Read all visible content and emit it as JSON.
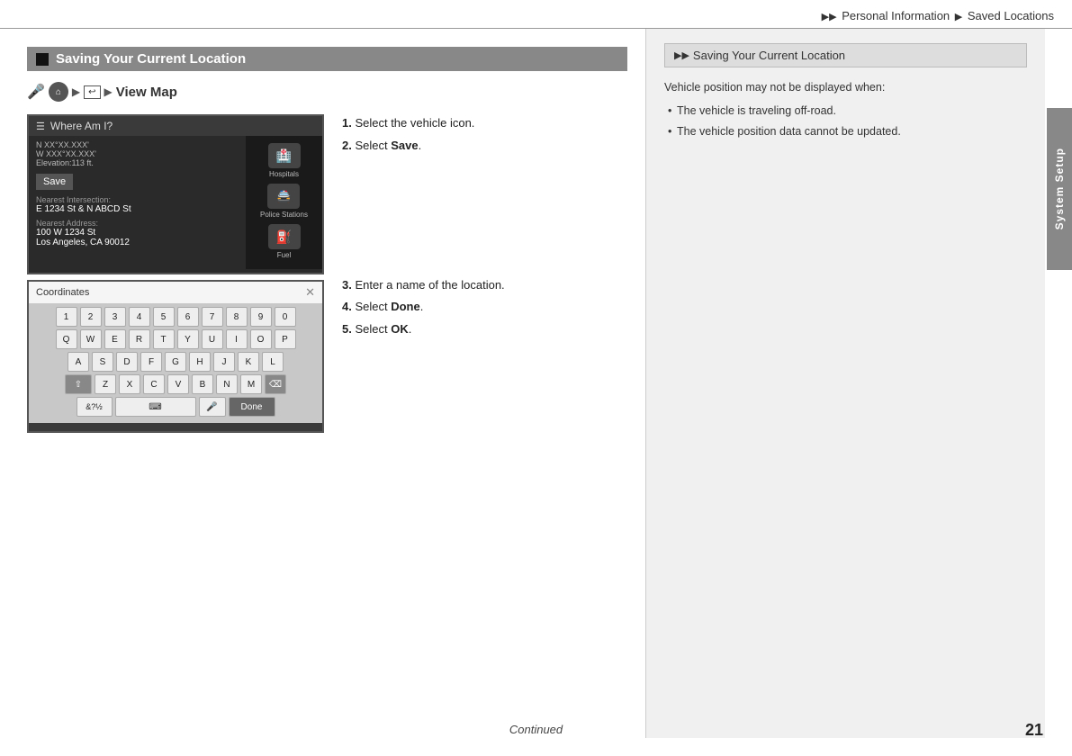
{
  "header": {
    "breadcrumb": "Personal Information",
    "breadcrumb2": "Saved Locations"
  },
  "right_tab": {
    "label": "System Setup"
  },
  "page_number": "21",
  "continued": "Continued",
  "section": {
    "title": "Saving Your Current Location",
    "nav_label": "View Map"
  },
  "screen1": {
    "title": "Where Am I?",
    "save_btn": "Save",
    "label1": "N XX°XX.XXX'",
    "label2": "W XXX°XX.XXX'",
    "label3": "Elevation:113 ft.",
    "nearest_intersection_label": "Nearest Intersection:",
    "nearest_intersection": "E 1234 St & N ABCD St",
    "nearest_address_label": "Nearest Address:",
    "nearest_address": "100 W 1234 St",
    "nearest_address2": "Los Angeles, CA 90012",
    "sidebar_items": [
      "Hospitals",
      "Police Stations",
      "Fuel"
    ]
  },
  "screen2": {
    "header": "Coordinates",
    "close_icon": "✕",
    "rows": [
      [
        "1",
        "2",
        "3",
        "4",
        "5",
        "6",
        "7",
        "8",
        "9",
        "0"
      ],
      [
        "Q",
        "W",
        "E",
        "R",
        "T",
        "Y",
        "U",
        "I",
        "O",
        "P"
      ],
      [
        "A",
        "S",
        "D",
        "F",
        "G",
        "H",
        "J",
        "K",
        "L"
      ],
      [
        "⇧",
        "Z",
        "X",
        "C",
        "V",
        "B",
        "N",
        "M",
        "⌫"
      ]
    ],
    "bottom_row": [
      "&?½",
      "🎤",
      "Done"
    ]
  },
  "instructions": [
    {
      "num": "1.",
      "text": "Select the vehicle icon."
    },
    {
      "num": "2.",
      "text": "Select ",
      "bold": "Save",
      "rest": "."
    },
    {
      "num": "3.",
      "text": "Enter a name of the location."
    },
    {
      "num": "4.",
      "text": "Select ",
      "bold": "Done",
      "rest": "."
    },
    {
      "num": "5.",
      "text": "Select ",
      "bold": "OK",
      "rest": "."
    }
  ],
  "right_panel": {
    "header": "Saving Your Current Location",
    "intro": "Vehicle position may not be displayed when:",
    "bullets": [
      "The vehicle is traveling off-road.",
      "The vehicle position data cannot be updated."
    ]
  }
}
